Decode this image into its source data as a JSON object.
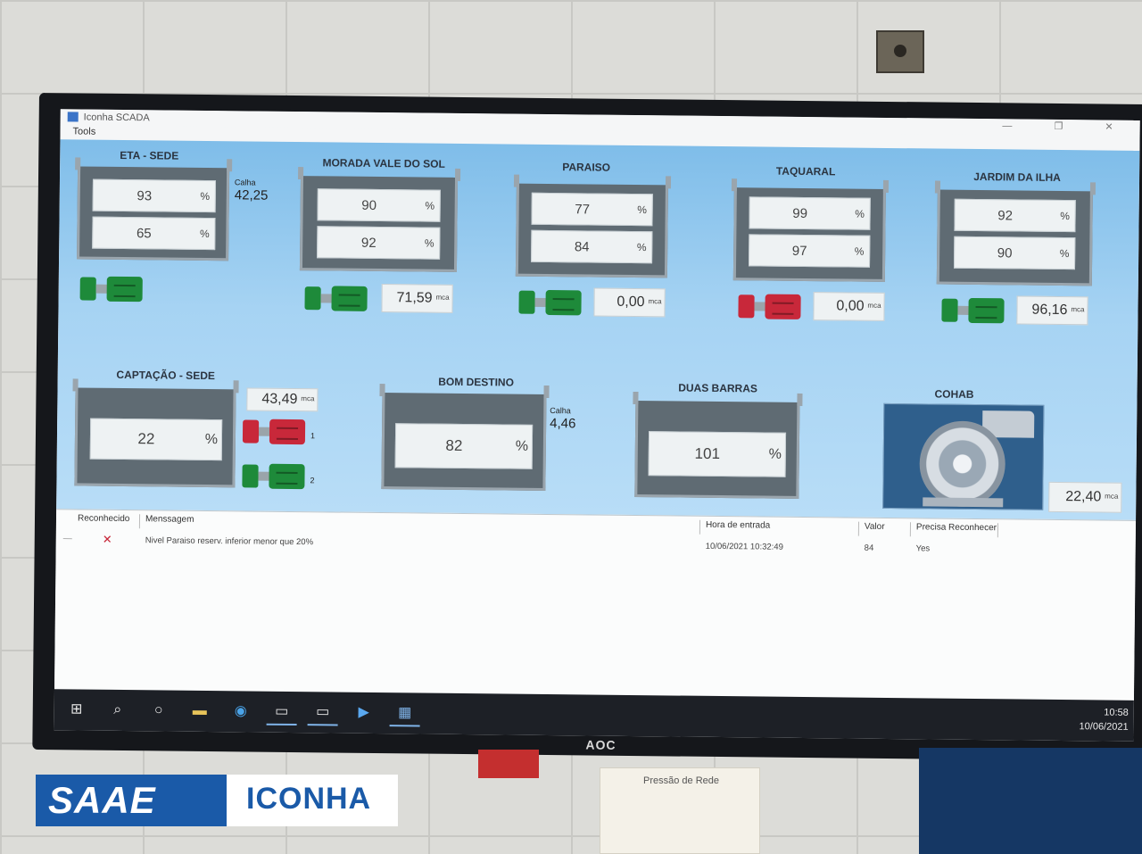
{
  "window": {
    "title": "Iconha SCADA",
    "menu_tools": "Tools",
    "controls": "— ❐ ✕"
  },
  "stations": {
    "eta_sede": {
      "title": "ETA - SEDE",
      "level1": "93",
      "level2": "65",
      "unit": "%",
      "calha_label": "Calha",
      "calha_value": "42,25"
    },
    "morada": {
      "title": "MORADA VALE DO SOL",
      "level1": "90",
      "level2": "92",
      "unit": "%",
      "pressure": "71,59",
      "pressure_unit": "mca"
    },
    "paraiso": {
      "title": "PARAISO",
      "level1": "77",
      "level2": "84",
      "unit": "%",
      "pressure": "0,00",
      "pressure_unit": "mca"
    },
    "taquaral": {
      "title": "TAQUARAL",
      "level1": "99",
      "level2": "97",
      "unit": "%",
      "pressure": "0,00",
      "pressure_unit": "mca"
    },
    "jardim": {
      "title": "JARDIM DA ILHA",
      "level1": "92",
      "level2": "90",
      "unit": "%",
      "pressure": "96,16",
      "pressure_unit": "mca"
    },
    "captacao": {
      "title": "CAPTAÇÃO - SEDE",
      "level": "22",
      "unit": "%",
      "pressure": "43,49",
      "pressure_unit": "mca",
      "pump1": "1",
      "pump2": "2"
    },
    "bom_destino": {
      "title": "BOM DESTINO",
      "level": "82",
      "unit": "%",
      "calha_label": "Calha",
      "calha_value": "4,46"
    },
    "duas_barras": {
      "title": "DUAS BARRAS",
      "level": "101",
      "unit": "%"
    },
    "cohab": {
      "title": "COHAB",
      "pressure": "22,40",
      "pressure_unit": "mca"
    }
  },
  "alarms": {
    "columns": [
      "Reconhecido",
      "Menssagem",
      "Hora de entrada",
      "Valor",
      "Precisa Reconhecer"
    ],
    "rows": [
      {
        "ack": "✕",
        "message": "Nivel Paraiso reserv. inferior menor que 20%",
        "time": "10/06/2021 10:32:49",
        "value": "84",
        "needs_ack": "Yes"
      }
    ]
  },
  "taskbar": {
    "time": "10:58",
    "date": "10/06/2021"
  },
  "monitor_brand": "AOC",
  "overlay": {
    "logo_left": "SAAE",
    "logo_right": "ICONHA"
  },
  "wall_paper_title": "Pressão de Rede",
  "colors": {
    "pump_on": "#1e8a3a",
    "pump_off": "#c8283a",
    "hmi_background": "#a6d3f3"
  }
}
